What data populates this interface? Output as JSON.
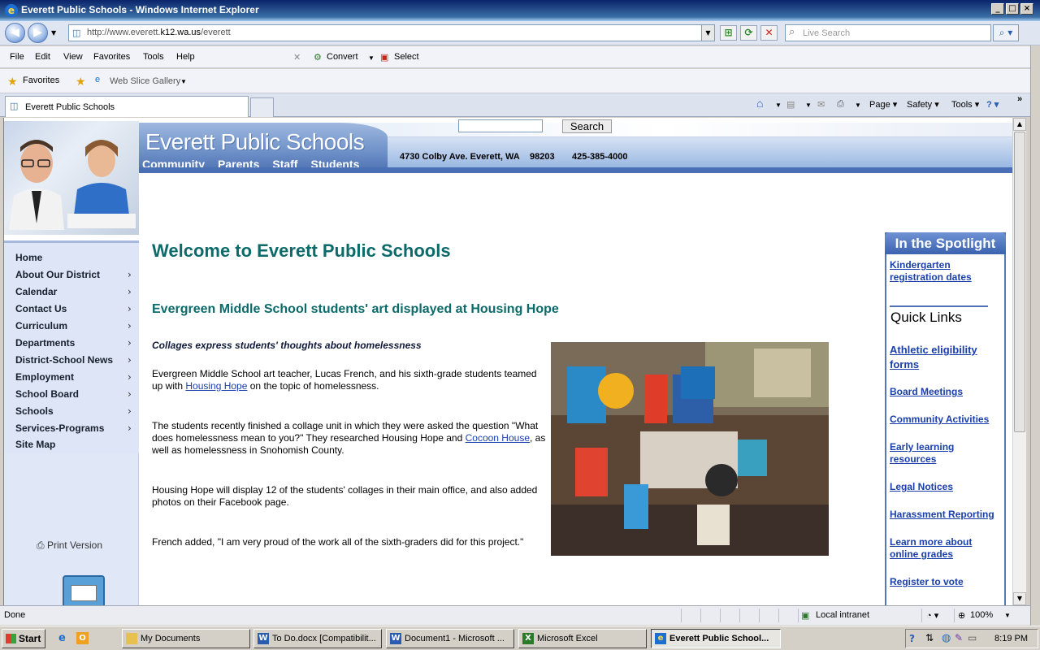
{
  "window": {
    "title": "Everett Public Schools - Windows Internet Explorer"
  },
  "browser": {
    "url_prefix": "http://www.everett.",
    "url_host": "k12.wa.us",
    "url_path": "/everett",
    "search_placeholder": "Live Search",
    "menu": [
      "File",
      "Edit",
      "View",
      "Favorites",
      "Tools",
      "Help"
    ],
    "convert_label": "Convert",
    "select_label": "Select",
    "favorites_label": "Favorites",
    "webslice_label": "Web Slice Gallery",
    "tab_title": "Everett Public Schools",
    "commands": {
      "page": "Page",
      "safety": "Safety",
      "tools": "Tools"
    }
  },
  "site": {
    "title": "Everett Public Schools",
    "topnav": [
      "Community",
      "Parents",
      "Staff",
      "Students"
    ],
    "address": "4730 Colby Ave. Everett, WA",
    "zip": "98203",
    "phone": "425-385-4000",
    "search_button": "Search"
  },
  "leftnav": {
    "items": [
      {
        "label": "Home",
        "arrow": false
      },
      {
        "label": "About Our District",
        "arrow": true
      },
      {
        "label": "Calendar",
        "arrow": true
      },
      {
        "label": "Contact Us",
        "arrow": true
      },
      {
        "label": "Curriculum",
        "arrow": true
      },
      {
        "label": "Departments",
        "arrow": true
      },
      {
        "label": "District-School News",
        "arrow": true
      },
      {
        "label": "Employment",
        "arrow": true
      },
      {
        "label": "School Board",
        "arrow": true
      },
      {
        "label": "Schools",
        "arrow": true
      },
      {
        "label": "Services-Programs",
        "arrow": true
      },
      {
        "label": "Site Map",
        "arrow": false
      }
    ],
    "print_label": "Print Version"
  },
  "content": {
    "welcome": "Welcome to Everett Public Schools",
    "headline": "Evergreen Middle School students' art displayed at Housing Hope",
    "subhead": "Collages express students' thoughts about homelessness",
    "p1_before": "Evergreen Middle School art teacher, Lucas French, and his sixth-grade students teamed up with ",
    "p1_link": "Housing Hope",
    "p1_after": " on the topic of homelessness.",
    "p2_before": "The students recently finished a collage unit in which they were asked the question \"What does homelessness mean to you?\" They researched Housing Hope and ",
    "p2_link": "Cocoon House",
    "p2_after": ", as well as homelessness in Snohomish County.",
    "p3": "Housing Hope will display 12 of the students' collages in their main office, and also added photos on their Facebook page.",
    "p4": "French added, \"I am very proud of the work all of the sixth-graders did for this project.\""
  },
  "spotlight": {
    "heading": "In the Spotlight",
    "featured": "Kindergarten registration dates",
    "quick_links_heading": "Quick Links",
    "links": [
      "Athletic eligibility forms",
      "Board Meetings",
      "Community Activities",
      "Early learning resources",
      "Legal Notices",
      "Harassment Reporting",
      "Learn more about online grades",
      "Register to vote"
    ]
  },
  "status": {
    "text": "Done",
    "zone": "Local intranet",
    "zoom": "100%"
  },
  "taskbar": {
    "start": "Start",
    "tasks": [
      "My Documents",
      "To Do.docx [Compatibilit...",
      "Document1 - Microsoft ...",
      "Microsoft Excel",
      "Everett Public School..."
    ],
    "clock": "8:19 PM"
  }
}
